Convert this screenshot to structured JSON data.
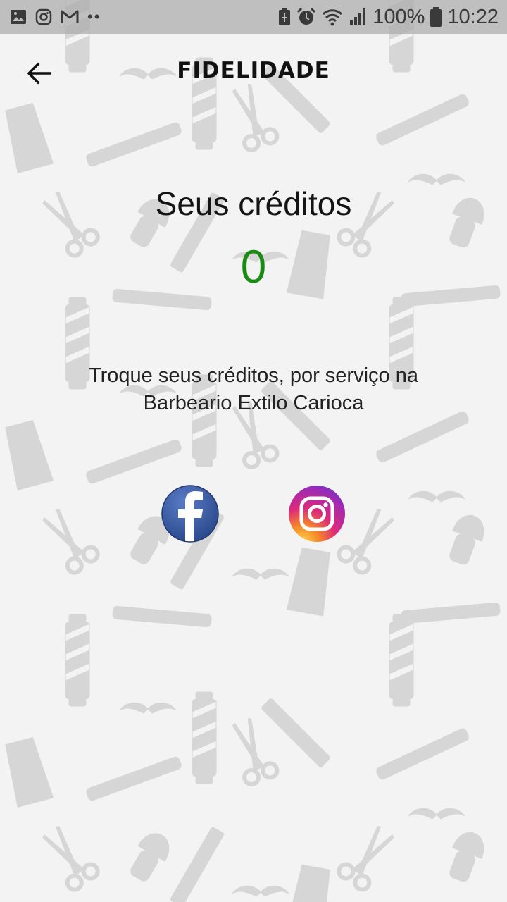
{
  "status_bar": {
    "battery_percent": "100%",
    "time": "10:22",
    "notification_icons": [
      "image-icon",
      "instagram-icon",
      "gmail-icon",
      "more-dots-icon"
    ],
    "system_icons": [
      "battery-saver-icon",
      "alarm-icon",
      "wifi-icon",
      "signal-icon",
      "battery-icon"
    ]
  },
  "header": {
    "title": "FIDELIDADE",
    "back_icon": "arrow-left-icon"
  },
  "credits": {
    "label": "Seus créditos",
    "value": "0",
    "value_color": "#1a8a14"
  },
  "info": {
    "text": "Troque seus créditos, por serviço na Barbeario Extilo Carioca"
  },
  "social_links": [
    {
      "name": "facebook",
      "icon": "facebook-icon",
      "color": "#3b5998"
    },
    {
      "name": "instagram",
      "icon": "instagram-icon",
      "color": "#d6249f"
    }
  ]
}
